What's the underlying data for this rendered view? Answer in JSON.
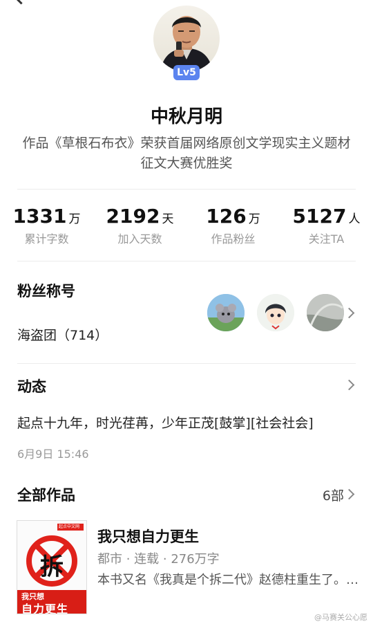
{
  "profile": {
    "name": "中秋月明",
    "level": "Lv5",
    "bio": "作品《草根石布衣》荣获首届网络原创文学现实主义题材征文大赛优胜奖"
  },
  "stats": [
    {
      "value": "1331",
      "unit": "万",
      "label": "累计字数"
    },
    {
      "value": "2192",
      "unit": "天",
      "label": "加入天数"
    },
    {
      "value": "126",
      "unit": "万",
      "label": "作品粉丝"
    },
    {
      "value": "5127",
      "unit": "人",
      "label": "关注TA"
    }
  ],
  "fans": {
    "title": "粉丝称号",
    "name": "海盗团（714）"
  },
  "feed": {
    "title": "动态",
    "post": "起点十九年，时光荏苒，少年正茂[鼓掌][社会社会]",
    "date": "6月9日 15:46"
  },
  "works": {
    "title": "全部作品",
    "count": "6部",
    "book": {
      "title": "我只想自力更生",
      "meta": "都市 · 连载 · 276万字",
      "desc": "本书又名《我真是个拆二代》赵德柱重生了。…",
      "cover_brand": "起点中文网",
      "cover_char": "拆",
      "cover_sub": "我只想",
      "cover_main": "自力更生"
    }
  },
  "watermark": "@马赛关公心愿"
}
